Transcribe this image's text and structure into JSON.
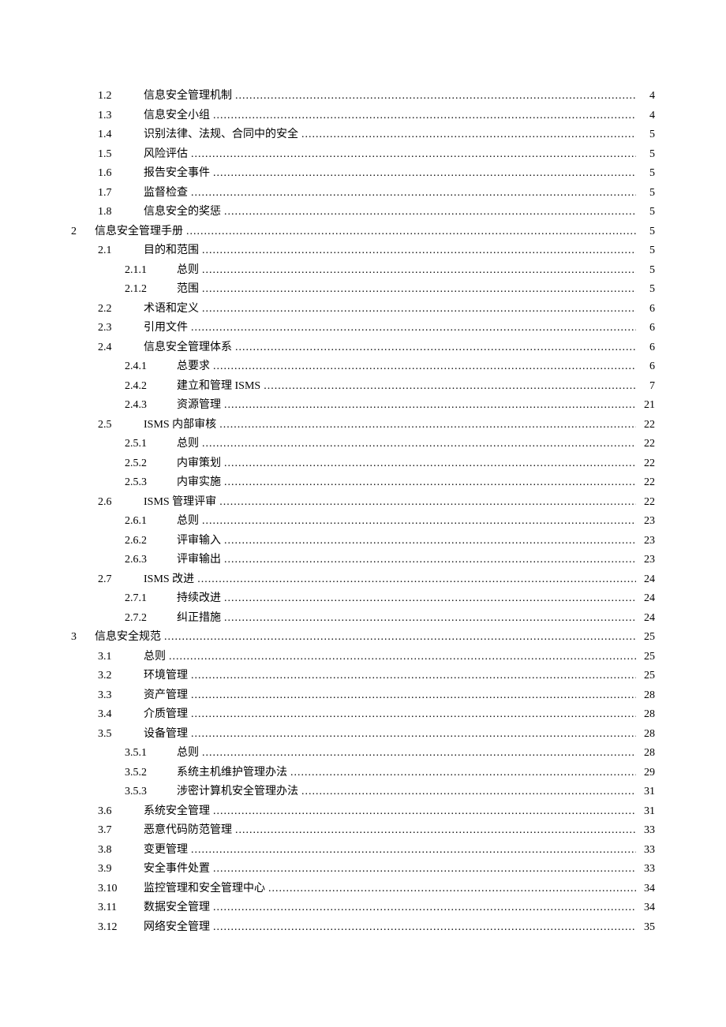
{
  "toc": [
    {
      "level": 1,
      "num": "1.2",
      "title": "信息安全管理机制",
      "page": "4"
    },
    {
      "level": 1,
      "num": "1.3",
      "title": "信息安全小组",
      "page": "4"
    },
    {
      "level": 1,
      "num": "1.4",
      "title": "识别法律、法规、合同中的安全",
      "page": "5"
    },
    {
      "level": 1,
      "num": "1.5",
      "title": "风险评估",
      "page": "5"
    },
    {
      "level": 1,
      "num": "1.6",
      "title": "报告安全事件",
      "page": "5"
    },
    {
      "level": 1,
      "num": "1.7",
      "title": "监督检查",
      "page": "5"
    },
    {
      "level": 1,
      "num": "1.8",
      "title": "信息安全的奖惩",
      "page": "5"
    },
    {
      "level": 0,
      "num": "2",
      "title": "信息安全管理手册",
      "page": "5"
    },
    {
      "level": 1,
      "num": "2.1",
      "title": "目的和范围",
      "page": "5"
    },
    {
      "level": 2,
      "num": "2.1.1",
      "title": "总则",
      "page": "5"
    },
    {
      "level": 2,
      "num": "2.1.2",
      "title": "范围",
      "page": "5"
    },
    {
      "level": 1,
      "num": "2.2",
      "title": "术语和定义",
      "page": "6"
    },
    {
      "level": 1,
      "num": "2.3",
      "title": "引用文件",
      "page": "6"
    },
    {
      "level": 1,
      "num": "2.4",
      "title": "信息安全管理体系",
      "page": "6"
    },
    {
      "level": 2,
      "num": "2.4.1",
      "title": "总要求",
      "page": "6"
    },
    {
      "level": 2,
      "num": "2.4.2",
      "title": "建立和管理 ISMS",
      "page": "7"
    },
    {
      "level": 2,
      "num": "2.4.3",
      "title": "资源管理",
      "page": "21"
    },
    {
      "level": 1,
      "num": "2.5",
      "title": "ISMS 内部审核",
      "page": "22"
    },
    {
      "level": 2,
      "num": "2.5.1",
      "title": "总则",
      "page": "22"
    },
    {
      "level": 2,
      "num": "2.5.2",
      "title": "内审策划",
      "page": "22"
    },
    {
      "level": 2,
      "num": "2.5.3",
      "title": "内审实施",
      "page": "22"
    },
    {
      "level": 1,
      "num": "2.6",
      "title": "ISMS 管理评审",
      "page": "22"
    },
    {
      "level": 2,
      "num": "2.6.1",
      "title": "总则",
      "page": "23"
    },
    {
      "level": 2,
      "num": "2.6.2",
      "title": "评审输入",
      "page": "23"
    },
    {
      "level": 2,
      "num": "2.6.3",
      "title": "评审输出",
      "page": "23"
    },
    {
      "level": 1,
      "num": "2.7",
      "title": "ISMS 改进",
      "page": "24"
    },
    {
      "level": 2,
      "num": "2.7.1",
      "title": "持续改进",
      "page": "24"
    },
    {
      "level": 2,
      "num": "2.7.2",
      "title": "纠正措施",
      "page": "24"
    },
    {
      "level": 0,
      "num": "3",
      "title": "信息安全规范",
      "page": "25"
    },
    {
      "level": 1,
      "num": "3.1",
      "title": "总则",
      "page": "25"
    },
    {
      "level": 1,
      "num": "3.2",
      "title": "环境管理",
      "page": "25"
    },
    {
      "level": 1,
      "num": "3.3",
      "title": "资产管理",
      "page": "28"
    },
    {
      "level": 1,
      "num": "3.4",
      "title": "介质管理",
      "page": "28"
    },
    {
      "level": 1,
      "num": "3.5",
      "title": "设备管理",
      "page": "28"
    },
    {
      "level": 2,
      "num": "3.5.1",
      "title": "总则",
      "page": "28"
    },
    {
      "level": 2,
      "num": "3.5.2",
      "title": "系统主机维护管理办法",
      "page": "29"
    },
    {
      "level": 2,
      "num": "3.5.3",
      "title": "涉密计算机安全管理办法",
      "page": "31"
    },
    {
      "level": 1,
      "num": "3.6",
      "title": "系统安全管理",
      "page": "31"
    },
    {
      "level": 1,
      "num": "3.7",
      "title": "恶意代码防范管理",
      "page": "33"
    },
    {
      "level": 1,
      "num": "3.8",
      "title": "变更管理",
      "page": "33"
    },
    {
      "level": 1,
      "num": "3.9",
      "title": "安全事件处置",
      "page": "33"
    },
    {
      "level": 1,
      "num": "3.10",
      "title": "监控管理和安全管理中心",
      "page": "34"
    },
    {
      "level": 1,
      "num": "3.11",
      "title": "数据安全管理",
      "page": "34"
    },
    {
      "level": 1,
      "num": "3.12",
      "title": "网络安全管理",
      "page": "35"
    }
  ]
}
